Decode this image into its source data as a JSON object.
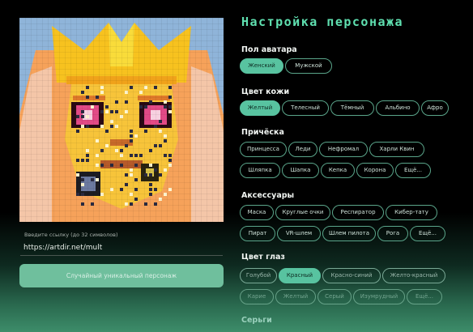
{
  "link": {
    "hint": "Введите ссылку (до 32 символов)",
    "value": "https://artdir.net/mult"
  },
  "random_button": "Случайный уникальный персонаж",
  "panel": {
    "title": "Настройка персонажа",
    "sections": [
      {
        "title": "Пол аватара",
        "rows": [
          [
            {
              "label": "Женский",
              "state": "active"
            },
            {
              "label": "Мужской",
              "state": "normal"
            }
          ]
        ]
      },
      {
        "title": "Цвет кожи",
        "rows": [
          [
            {
              "label": "Желтый",
              "state": "active"
            },
            {
              "label": "Телесный",
              "state": "normal"
            },
            {
              "label": "Тёмный",
              "state": "normal"
            },
            {
              "label": "Альбино",
              "state": "normal"
            },
            {
              "label": "Афро",
              "state": "normal"
            }
          ]
        ]
      },
      {
        "title": "Причёска",
        "rows": [
          [
            {
              "label": "Принцесса",
              "state": "normal"
            },
            {
              "label": "Леди",
              "state": "normal"
            },
            {
              "label": "Нефромал",
              "state": "normal"
            },
            {
              "label": "Харли Квин",
              "state": "normal"
            }
          ],
          [
            {
              "label": "Шляпка",
              "state": "normal"
            },
            {
              "label": "Шапка",
              "state": "normal"
            },
            {
              "label": "Кепка",
              "state": "normal"
            },
            {
              "label": "Корона",
              "state": "normal"
            },
            {
              "label": "Ещё...",
              "state": "normal"
            }
          ]
        ]
      },
      {
        "title": "Аксессуары",
        "rows": [
          [
            {
              "label": "Маска",
              "state": "normal"
            },
            {
              "label": "Круглые очки",
              "state": "normal"
            },
            {
              "label": "Респиратор",
              "state": "normal"
            },
            {
              "label": "Кибер-тату",
              "state": "normal"
            }
          ],
          [
            {
              "label": "Пират",
              "state": "normal"
            },
            {
              "label": "VR-шлем",
              "state": "normal"
            },
            {
              "label": "Шлем пилота",
              "state": "normal"
            },
            {
              "label": "Рога",
              "state": "normal"
            },
            {
              "label": "Ещё...",
              "state": "normal"
            }
          ]
        ]
      },
      {
        "title": "Цвет глаз",
        "rows": [
          [
            {
              "label": "Голубой",
              "state": "faded"
            },
            {
              "label": "Красный",
              "state": "active"
            },
            {
              "label": "Красно-синий",
              "state": "faded"
            },
            {
              "label": "Желто-красный",
              "state": "faded"
            }
          ],
          [
            {
              "label": "Карие",
              "state": "ghost"
            },
            {
              "label": "Желтый",
              "state": "ghost"
            },
            {
              "label": "Серый",
              "state": "ghost"
            },
            {
              "label": "Изумрудный",
              "state": "ghost"
            },
            {
              "label": "Ещё...",
              "state": "ghost"
            }
          ]
        ]
      },
      {
        "title": "Серьги",
        "rows": []
      }
    ]
  },
  "colors": {
    "accent": "#5fe0b0",
    "chip_active": "#58c3a0",
    "chip_border": "#5aa58a",
    "button": "#6fbf9d"
  }
}
